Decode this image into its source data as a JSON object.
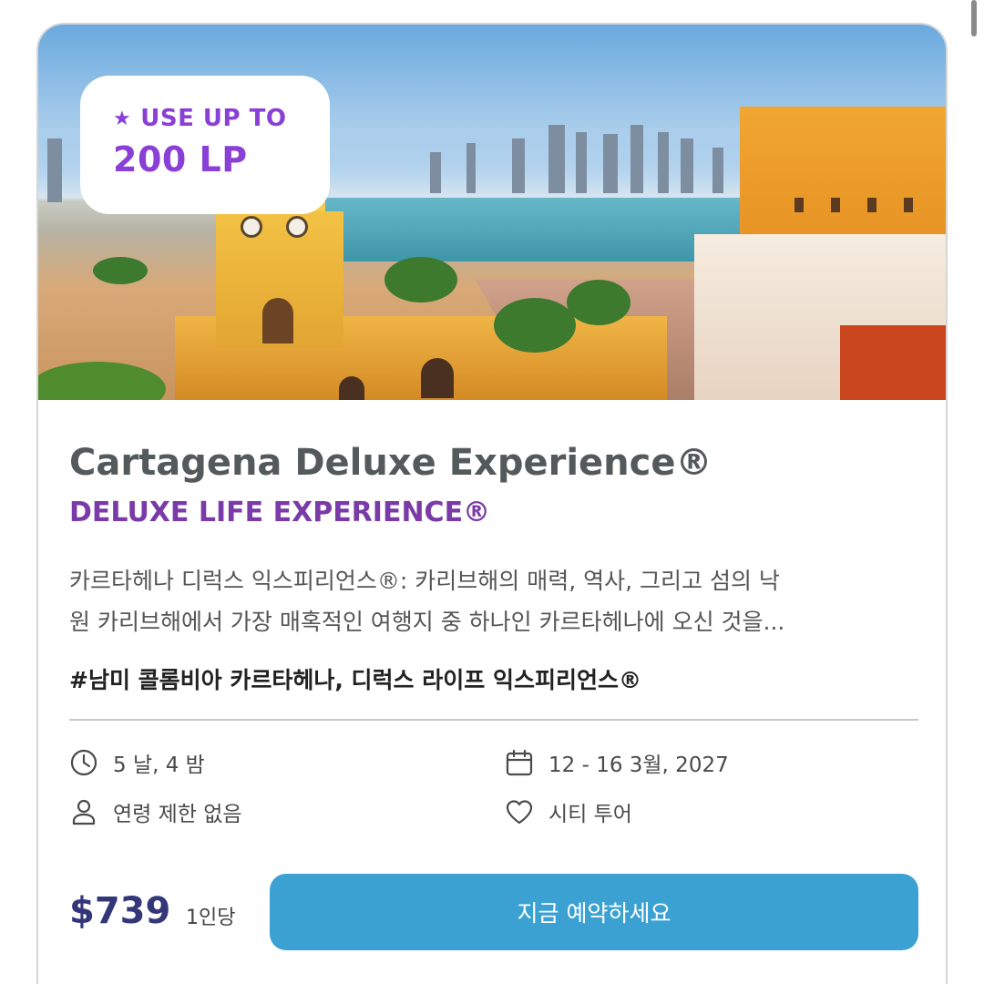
{
  "badge": {
    "star_icon": "star-icon",
    "label": "USE UP TO",
    "value": "200 LP"
  },
  "hero": {
    "image": "cartagena-clock-tower-photo"
  },
  "title": "Cartagena Deluxe Experience®",
  "subtitle": "DELUXE LIFE EXPERIENCE®",
  "description_line1": "카르타헤나 디럭스 익스피리언스®: 카리브해의 매력, 역사, 그리고 섬의 낙",
  "description_line2": "원 카리브해에서 가장 매혹적인 여행지 중 하나인 카르타헤나에 오신 것을...",
  "tags": "#남미 콜롬비아 카르타헤나, 디럭스 라이프 익스피리언스®",
  "details": {
    "duration": "5 날, 4 밤",
    "dates": "12 - 16 3월, 2027",
    "age": "연령 제한 없음",
    "category": "시티 투어"
  },
  "price": "$739",
  "price_unit": "1인당",
  "book_label": "지금 예약하세요",
  "colors": {
    "accent_purple": "#8a3fd6",
    "button_blue": "#3aa1d2",
    "price_navy": "#33377a"
  }
}
